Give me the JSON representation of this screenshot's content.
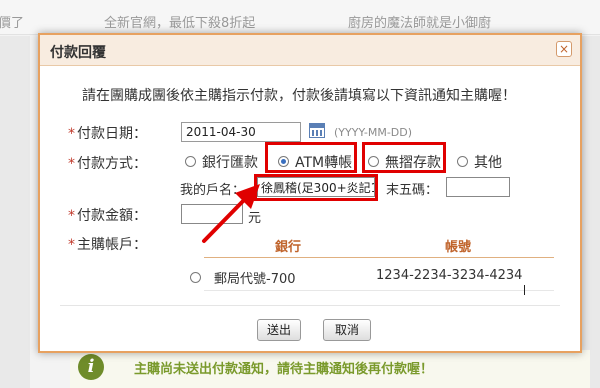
{
  "background": {
    "top_links": [
      "價了",
      "全新官網，最低下殺8折起",
      "廚房的魔法師就是小御廚"
    ],
    "notice": "主購尚未送出付款通知，請待主購通知後再付款喔！",
    "notice_icon": "i"
  },
  "dialog": {
    "title": "付款回覆",
    "close_icon": "×",
    "intro": "請在團購成團後依主購指示付款，付款後請填寫以下資訊通知主購喔！",
    "required_mark": "*",
    "payment_date": {
      "label": "付款日期：",
      "value": "2011-04-30",
      "format_hint": "(YYYY-MM-DD)"
    },
    "payment_method": {
      "label": "付款方式：",
      "options": [
        {
          "label": "銀行匯款",
          "selected": false
        },
        {
          "label": "ATM轉帳",
          "selected": true
        },
        {
          "label": "無摺存款",
          "selected": false
        },
        {
          "label": "其他",
          "selected": false
        }
      ],
      "account_name_label": "我的戶名：",
      "account_name_value": "徐鳳稽(足300+炎記10",
      "last_five_label": "末五碼：",
      "last_five_value": ""
    },
    "amount": {
      "label": "付款金額：",
      "value": "",
      "unit": "元"
    },
    "organizer_account": {
      "label": "主購帳戶：",
      "col_bank": "銀行",
      "col_account": "帳號",
      "rows": [
        {
          "bank": "郵局代號-700",
          "account": "1234-2234-3234-4234"
        }
      ]
    },
    "buttons": {
      "submit": "送出",
      "cancel": "取消"
    }
  },
  "annotation": {
    "color": "#e00000"
  }
}
